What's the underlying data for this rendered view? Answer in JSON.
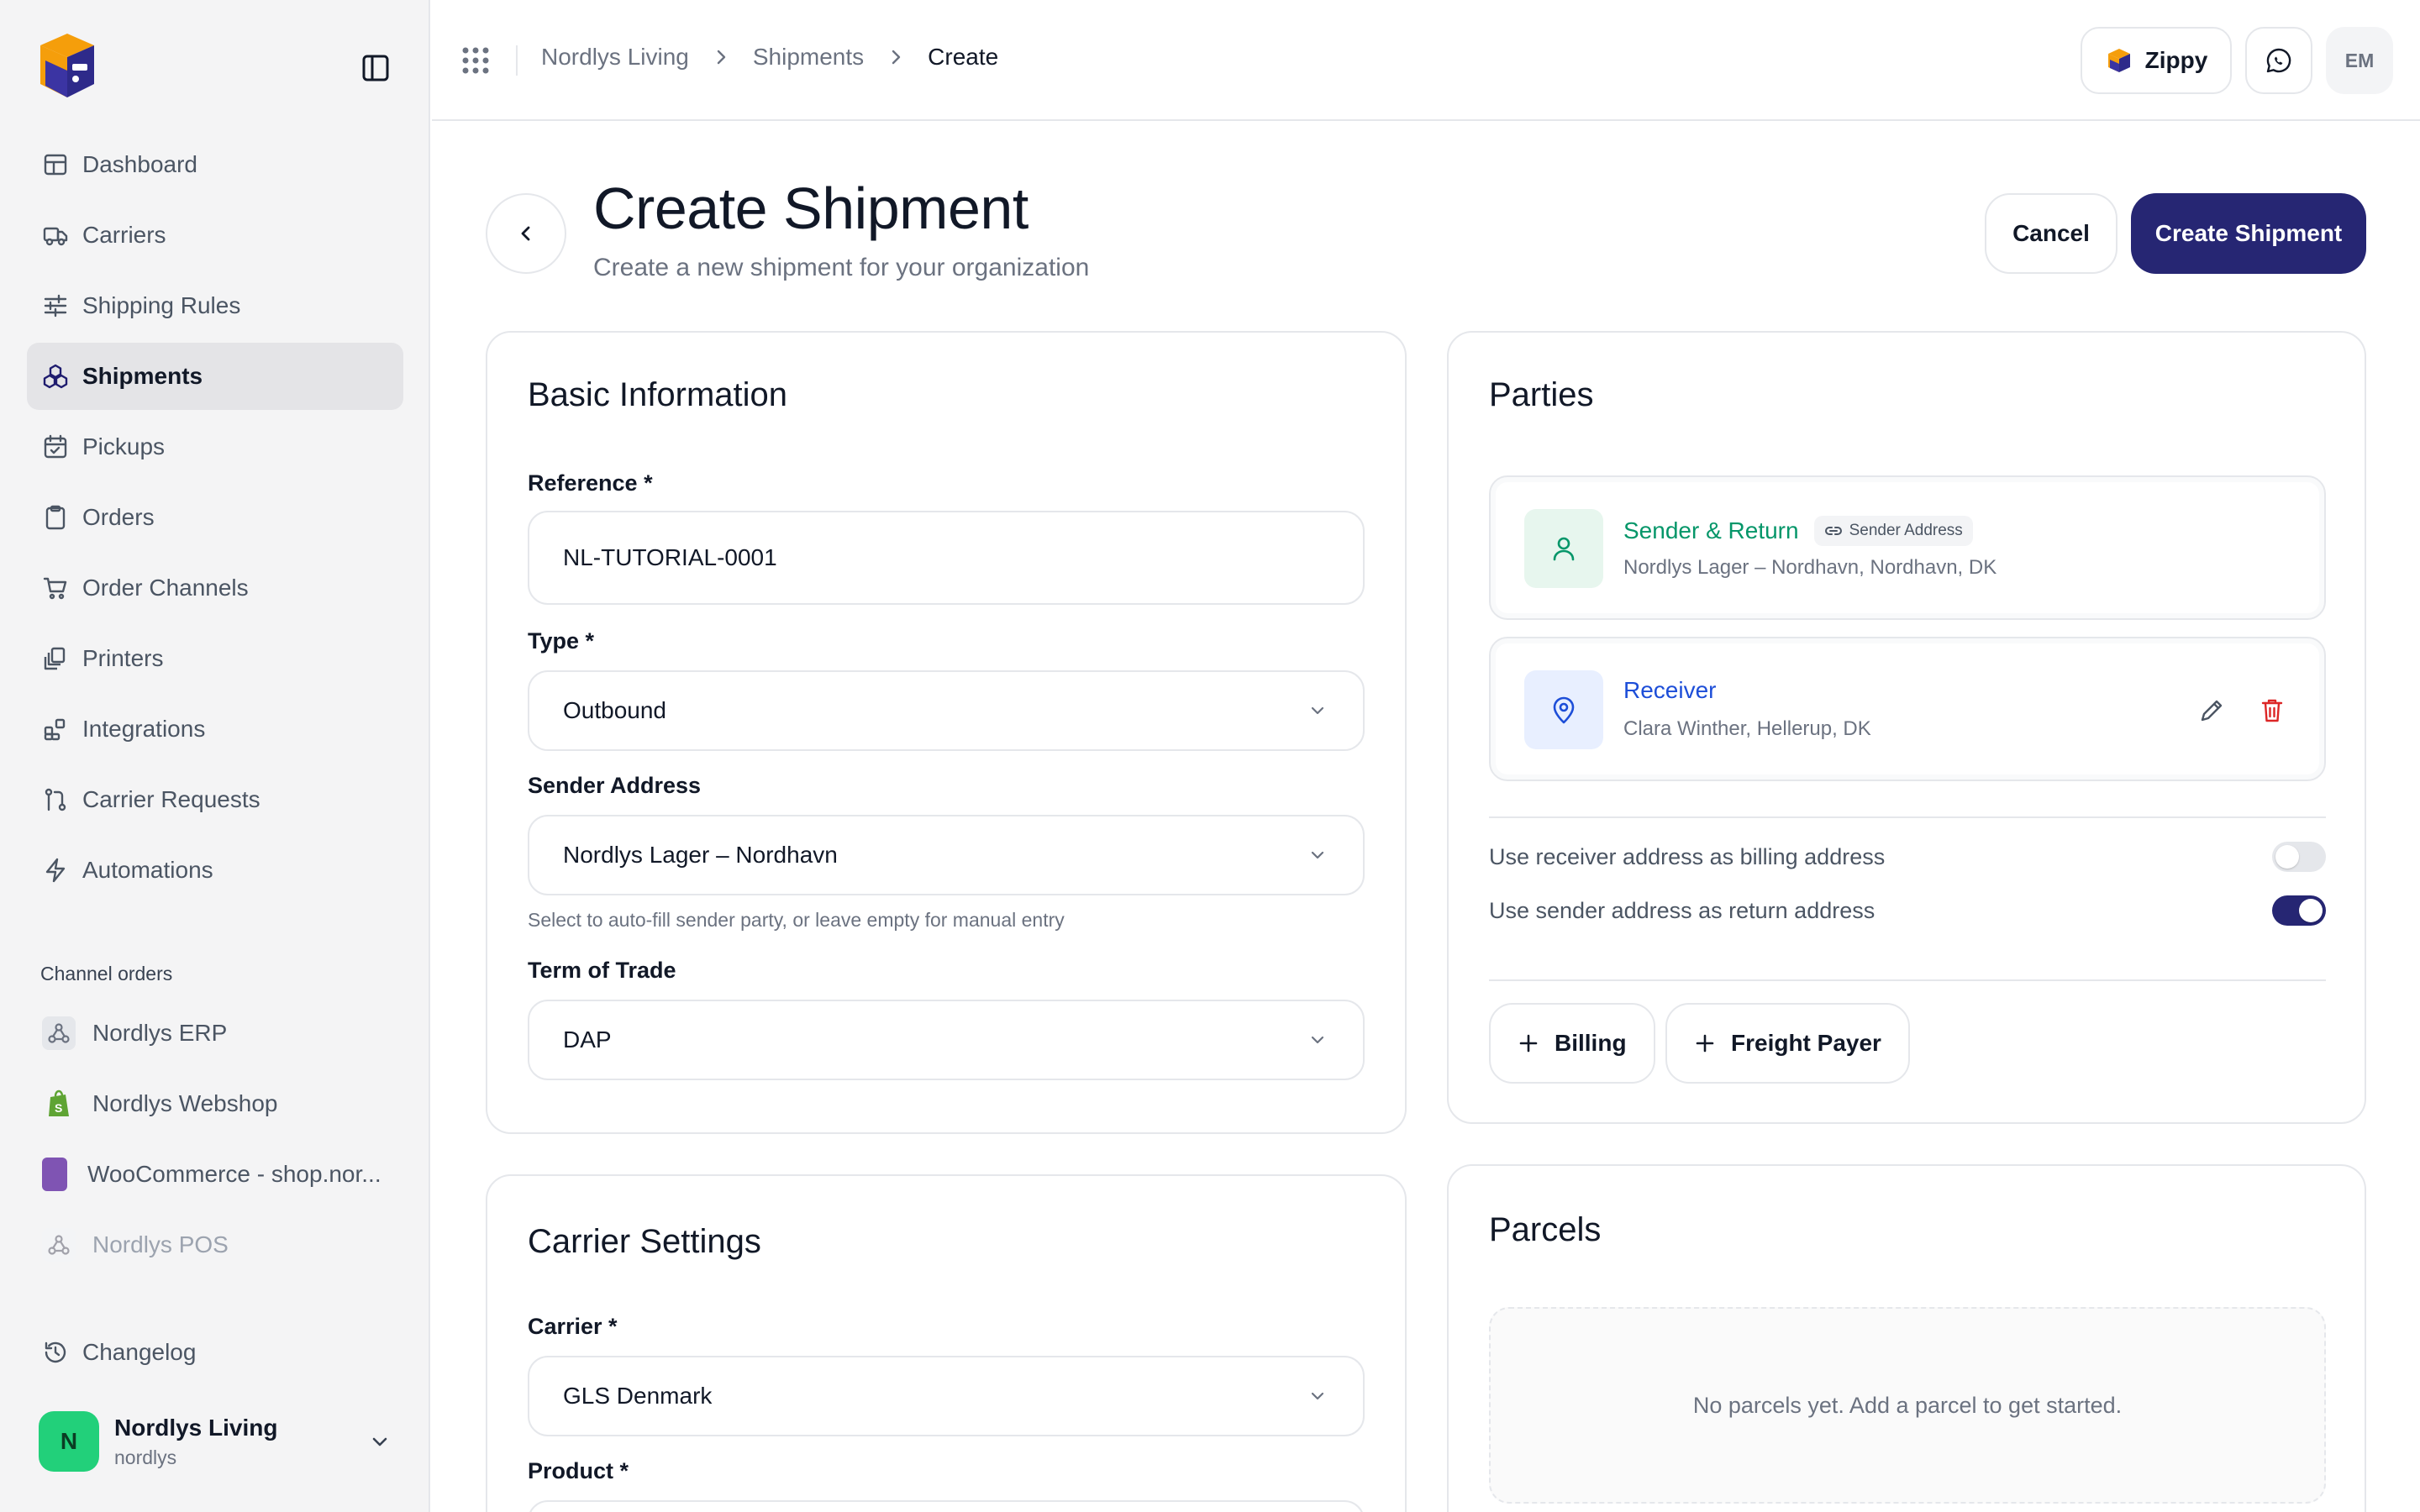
{
  "sidebar": {
    "nav": [
      {
        "label": "Dashboard",
        "icon": "dashboard-icon"
      },
      {
        "label": "Carriers",
        "icon": "truck-icon"
      },
      {
        "label": "Shipping Rules",
        "icon": "sliders-icon"
      },
      {
        "label": "Shipments",
        "icon": "shipments-icon",
        "active": true
      },
      {
        "label": "Pickups",
        "icon": "calendar-icon"
      },
      {
        "label": "Orders",
        "icon": "clipboard-icon"
      },
      {
        "label": "Order Channels",
        "icon": "cart-icon"
      },
      {
        "label": "Printers",
        "icon": "printer-icon"
      },
      {
        "label": "Integrations",
        "icon": "integrations-icon"
      },
      {
        "label": "Carrier Requests",
        "icon": "pull-request-icon"
      },
      {
        "label": "Automations",
        "icon": "lightning-icon"
      }
    ],
    "channels_label": "Channel orders",
    "channels": [
      {
        "label": "Nordlys ERP",
        "icon": "webhook-icon"
      },
      {
        "label": "Nordlys Webshop",
        "icon": "shopify-icon"
      },
      {
        "label": "WooCommerce - shop.nor...",
        "icon": "woocommerce-icon"
      },
      {
        "label": "Nordlys POS",
        "icon": "webhook-icon"
      }
    ],
    "changelog_label": "Changelog",
    "org": {
      "initial": "N",
      "name": "Nordlys Living",
      "slug": "nordlys"
    }
  },
  "topbar": {
    "breadcrumb": [
      "Nordlys Living",
      "Shipments",
      "Create"
    ],
    "zippy_label": "Zippy",
    "user_initials": "EM"
  },
  "header": {
    "title": "Create Shipment",
    "subtitle": "Create a new shipment for your organization",
    "cancel_label": "Cancel",
    "create_label": "Create Shipment"
  },
  "basic": {
    "title": "Basic Information",
    "reference_label": "Reference *",
    "reference_value": "NL-TUTORIAL-0001",
    "type_label": "Type *",
    "type_value": "Outbound",
    "sender_label": "Sender Address",
    "sender_value": "Nordlys Lager – Nordhavn",
    "sender_helper": "Select to auto-fill sender party, or leave empty for manual entry",
    "term_label": "Term of Trade",
    "term_value": "DAP"
  },
  "carrier": {
    "title": "Carrier Settings",
    "carrier_label": "Carrier *",
    "carrier_value": "GLS Denmark",
    "product_label": "Product *"
  },
  "parties": {
    "title": "Parties",
    "sender": {
      "title": "Sender & Return",
      "badge": "Sender Address",
      "detail": "Nordlys Lager – Nordhavn, Nordhavn, DK"
    },
    "receiver": {
      "title": "Receiver",
      "detail": "Clara Winther, Hellerup, DK"
    },
    "billing_toggle": "Use receiver address as billing address",
    "return_toggle": "Use sender address as return address",
    "billing_toggle_on": false,
    "return_toggle_on": true,
    "add_billing": "Billing",
    "add_freight": "Freight Payer"
  },
  "parcels": {
    "title": "Parcels",
    "empty": "No parcels yet. Add a parcel to get started."
  },
  "colors": {
    "brand": "#262673",
    "sender_green": "#059669",
    "receiver_blue": "#1d4ed8",
    "danger": "#dc2626"
  }
}
